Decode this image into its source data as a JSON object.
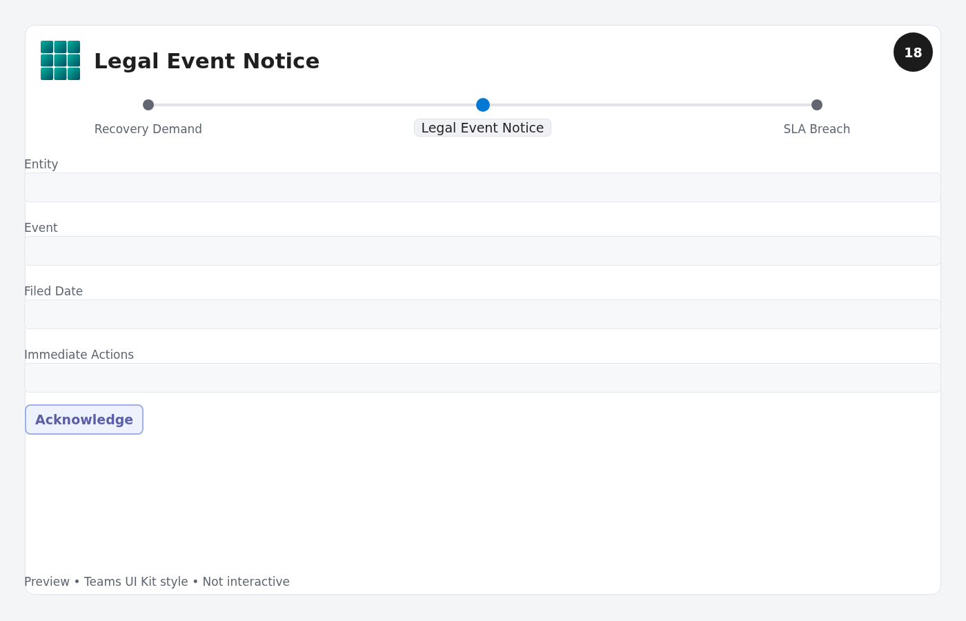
{
  "header": {
    "title": "Legal Event Notice",
    "badge": "18"
  },
  "steps": [
    {
      "label": "Recovery Demand",
      "selected": false
    },
    {
      "label": "Legal Event Notice",
      "selected": true
    },
    {
      "label": "SLA Breach",
      "selected": false
    }
  ],
  "fields": [
    {
      "label": "Entity"
    },
    {
      "label": "Event"
    },
    {
      "label": "Filed Date"
    },
    {
      "label": "Immediate Actions"
    }
  ],
  "button": "Acknowledge",
  "footer": "Preview • Teams UI Kit style • Not interactive"
}
